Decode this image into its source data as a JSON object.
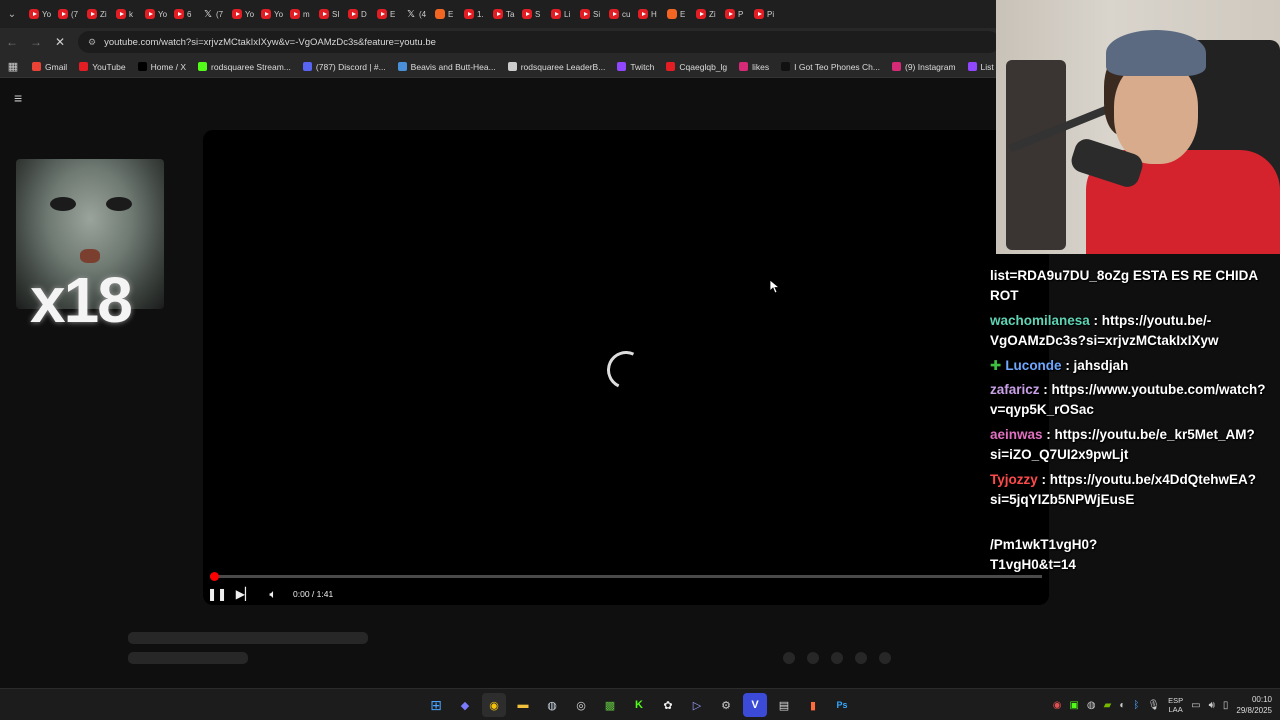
{
  "browser": {
    "tabs": [
      {
        "label": "Yo",
        "icon": "youtube-icon"
      },
      {
        "label": "(7",
        "icon": "youtube-icon"
      },
      {
        "label": "Zi",
        "icon": "youtube-icon"
      },
      {
        "label": "k",
        "icon": "youtube-icon"
      },
      {
        "label": "Yo",
        "icon": "youtube-icon"
      },
      {
        "label": "6",
        "icon": "youtube-icon"
      },
      {
        "label": "(7",
        "icon": "x-icon"
      },
      {
        "label": "Yo",
        "icon": "youtube-icon"
      },
      {
        "label": "Yo",
        "icon": "youtube-icon"
      },
      {
        "label": "m",
        "icon": "youtube-icon"
      },
      {
        "label": "SI",
        "icon": "youtube-icon"
      },
      {
        "label": "D",
        "icon": "youtube-icon"
      },
      {
        "label": "E",
        "icon": "youtube-icon"
      },
      {
        "label": "(4",
        "icon": "x-icon"
      },
      {
        "label": "E",
        "icon": "soundcloud-icon"
      },
      {
        "label": "1.",
        "icon": "youtube-icon"
      },
      {
        "label": "Ta",
        "icon": "youtube-icon"
      },
      {
        "label": "S",
        "icon": "youtube-icon"
      },
      {
        "label": "Li",
        "icon": "youtube-icon"
      },
      {
        "label": "Si",
        "icon": "youtube-icon"
      },
      {
        "label": "cu",
        "icon": "youtube-icon"
      },
      {
        "label": "H",
        "icon": "youtube-icon"
      },
      {
        "label": "E",
        "icon": "soundcloud-icon"
      },
      {
        "label": "Zi",
        "icon": "youtube-icon"
      },
      {
        "label": "P",
        "icon": "youtube-icon"
      },
      {
        "label": "Pi",
        "icon": "youtube-icon"
      }
    ],
    "url": "youtube.com/watch?si=xrjvzMCtakIxIXyw&v=-VgOAMzDc3s&feature=youtu.be",
    "bookmarks": [
      {
        "label": "Gmail",
        "icon": "gmail-icon",
        "color": "#ea4335"
      },
      {
        "label": "YouTube",
        "icon": "youtube-icon",
        "color": "#e21e24"
      },
      {
        "label": "Home / X",
        "icon": "x-icon",
        "color": "#000000"
      },
      {
        "label": "rodsquaree Stream...",
        "icon": "kick-icon",
        "color": "#53fc18"
      },
      {
        "label": "(787) Discord | #...",
        "icon": "discord-icon",
        "color": "#5865f2"
      },
      {
        "label": "Beavis and Butt-Hea...",
        "icon": "wiki-icon",
        "color": "#4a90d9"
      },
      {
        "label": "rodsquaree LeaderB...",
        "icon": "leaderboard-icon",
        "color": "#cccccc"
      },
      {
        "label": "Twitch",
        "icon": "twitch-icon",
        "color": "#9146ff"
      },
      {
        "label": "Cqaeglqb_lg",
        "icon": "youtube-icon",
        "color": "#e21e24"
      },
      {
        "label": "likes",
        "icon": "instagram-icon",
        "color": "#d62976"
      },
      {
        "label": "I Got Teo Phones Ch...",
        "icon": "tiktok-icon",
        "color": "#111111"
      },
      {
        "label": "(9) Instagram",
        "icon": "instagram-icon",
        "color": "#d62976"
      },
      {
        "label": "List of Pro",
        "icon": "twitch-icon",
        "color": "#9146ff"
      }
    ]
  },
  "player": {
    "time": "0:00 / 1:41",
    "progress": 0.0
  },
  "emote": {
    "multiplier": "x18"
  },
  "chat": {
    "messages": [
      {
        "user": "",
        "user_color": "#ffffff",
        "badge": "",
        "lines": [
          "list=RDA9u7DU_8oZg ESTA ES RE CHIDA",
          "ROT"
        ]
      },
      {
        "user": "wachomilanesa",
        "user_color": "#5fd3b3",
        "badge": "",
        "lines": [
          "wachomilanesa : https://youtu.be/-",
          "VgOAMzDc3s?si=xrjvzMCtakIxIXyw"
        ]
      },
      {
        "user": "Luconde",
        "user_color": "#6fa8ff",
        "badge": "✚",
        "lines": [
          "Luconde : jahsdjah"
        ]
      },
      {
        "user": "zafaricz",
        "user_color": "#c9a0e8",
        "badge": "",
        "lines": [
          "zafaricz : https://www.youtube.com/watch?",
          "v=qyp5K_rOSac"
        ]
      },
      {
        "user": "aeinwas",
        "user_color": "#e070c0",
        "badge": "",
        "lines": [
          "aeinwas : https://youtu.be/e_kr5Met_AM?",
          "si=iZO_Q7UI2x9pwLjt"
        ]
      },
      {
        "user": "Tyjozzy",
        "user_color": "#ff4a4a",
        "badge": "",
        "lines": [
          "Tyjozzy : https://youtu.be/x4DdQtehwEA?",
          "si=5jqYIZb5NPWjEusE"
        ]
      },
      {
        "user": "",
        "user_color": "#ffffff",
        "badge": "",
        "lines": [
          "/Pm1wkT1vgH0?",
          "T1vgH0&t=14"
        ]
      }
    ]
  },
  "taskbar": {
    "lang_top": "ESP",
    "lang_bottom": "LAA",
    "time": "00:10",
    "date": "29/8/2025"
  }
}
